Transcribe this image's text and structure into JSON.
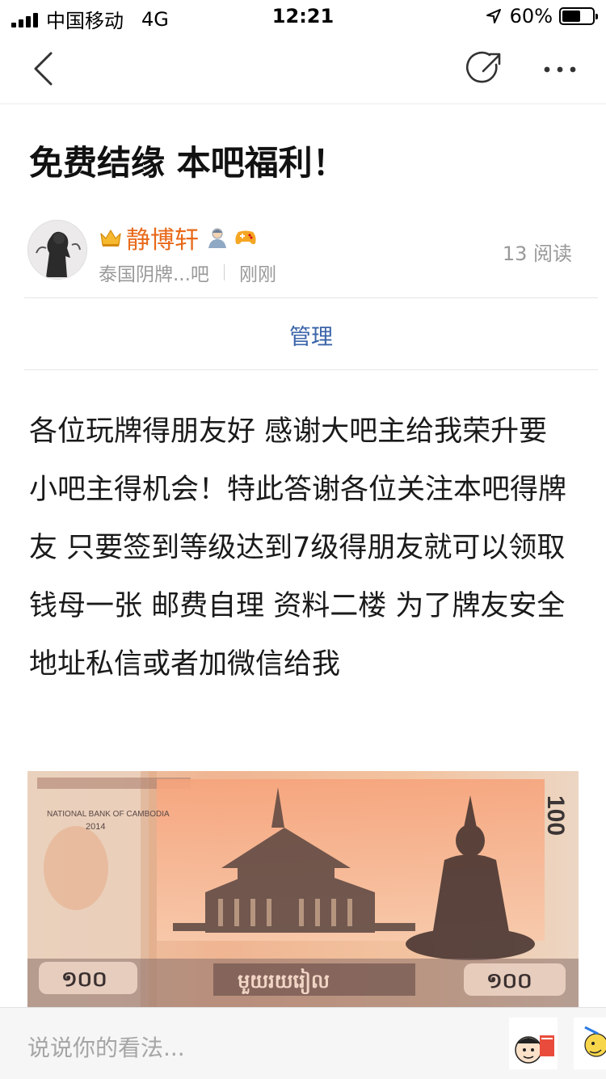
{
  "status_bar": {
    "carrier": "中国移动",
    "network": "4G",
    "time": "12:21",
    "battery_pct": "60%",
    "battery_level": 0.6
  },
  "nav": {
    "icons": [
      "back-icon",
      "share-icon",
      "more-icon"
    ]
  },
  "post": {
    "title": "免费结缘 本吧福利！",
    "author": {
      "name": "静博轩",
      "forum": "泰国阴牌...吧",
      "time": "刚刚"
    },
    "read_count": "13 阅读",
    "manage_label": "管理",
    "body": "各位玩牌得朋友好 感谢大吧主给我荣升要小吧主得机会！特此答谢各位关注本吧得牌友 只要签到等级达到7级得朋友就可以领取钱母一张 邮费自理 资料二楼 为了牌友安全地址私信或者加微信给我",
    "image": {
      "bank_text": "NATIONAL BANK OF CAMBODIA",
      "year": "2014",
      "denomination": "100",
      "left_numeral": "១០០",
      "right_numeral": "១០០",
      "khmer_script": "មួយរយរៀល"
    }
  },
  "comment_bar": {
    "placeholder": "说说你的看法..."
  },
  "colors": {
    "author_name": "#e8691a",
    "manage_link": "#3a64a8",
    "meta_text": "#9a9a9a"
  }
}
